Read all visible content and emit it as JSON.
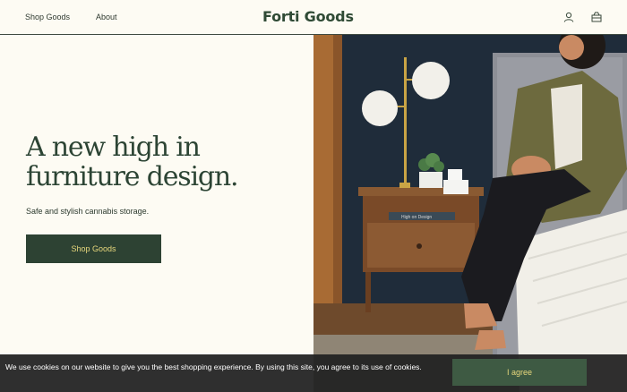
{
  "header": {
    "nav": [
      {
        "label": "Shop Goods"
      },
      {
        "label": "About"
      }
    ],
    "logo": "Forti Goods",
    "icons": [
      "account-icon",
      "cart-icon"
    ]
  },
  "hero": {
    "title": "A new high in furniture design.",
    "subtitle": "Safe and stylish cannabis storage.",
    "cta_label": "Shop Goods",
    "book_spine": "High on Design"
  },
  "cookie": {
    "text": "We use cookies on our website to give you the best shopping experience. By using this site, you agree to its use of cookies.",
    "button_label": "I agree"
  },
  "colors": {
    "background": "#fdfbf3",
    "brand_green": "#2d4233",
    "accent_yellow": "#e7d77c",
    "cookie_bar": "#222222"
  }
}
